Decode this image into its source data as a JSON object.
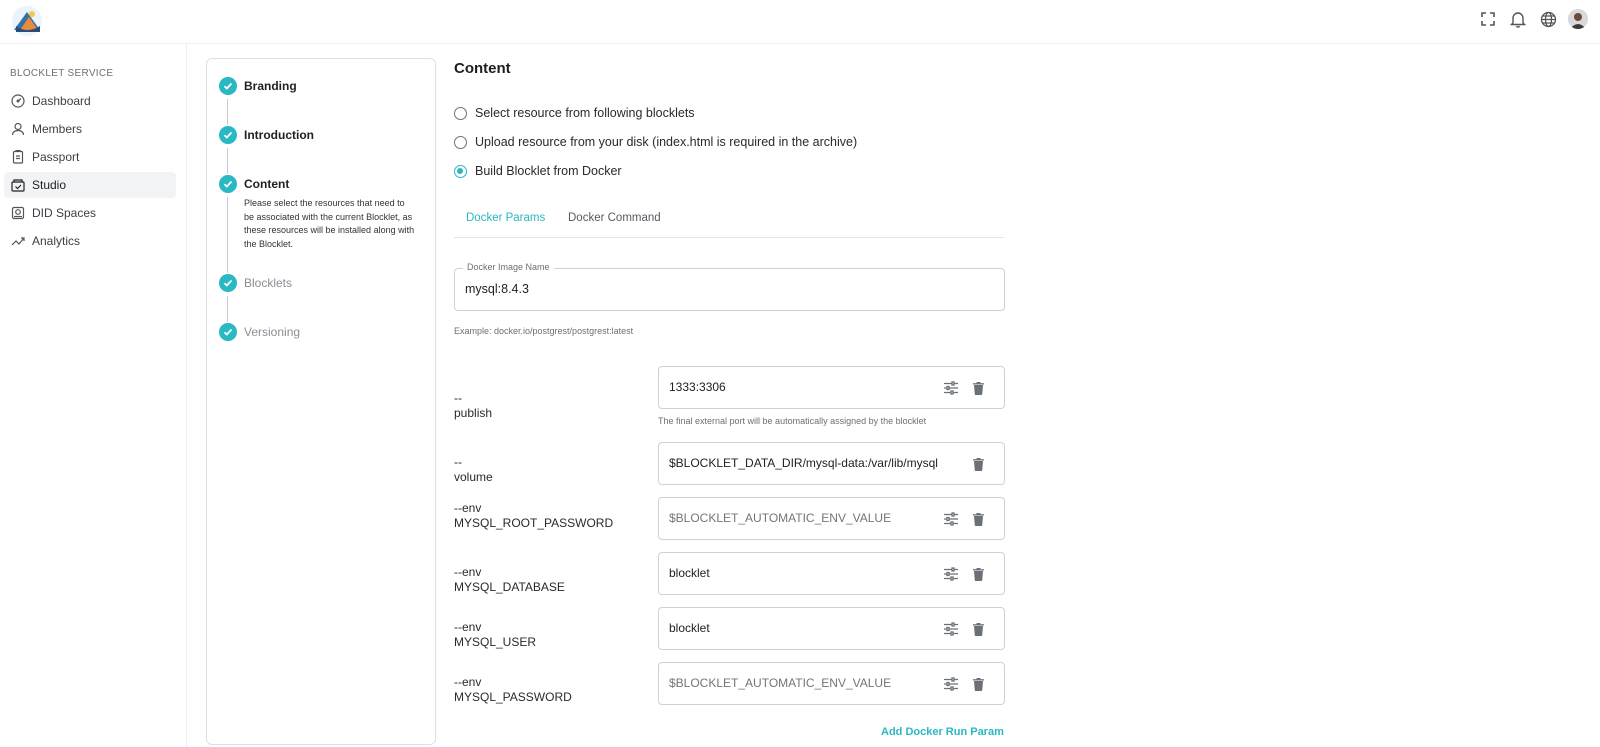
{
  "header": {
    "icons": [
      "fullscreen-icon",
      "bell-icon",
      "globe-icon",
      "avatar"
    ]
  },
  "sidebar": {
    "heading": "BLOCKLET SERVICE",
    "items": [
      {
        "label": "Dashboard",
        "icon": "dashboard-icon",
        "active": false
      },
      {
        "label": "Members",
        "icon": "user-icon",
        "active": false
      },
      {
        "label": "Passport",
        "icon": "passport-icon",
        "active": false
      },
      {
        "label": "Studio",
        "icon": "studio-icon",
        "active": true
      },
      {
        "label": "DID Spaces",
        "icon": "did-spaces-icon",
        "active": false
      },
      {
        "label": "Analytics",
        "icon": "analytics-icon",
        "active": false
      }
    ]
  },
  "stepper": {
    "steps": [
      {
        "label": "Branding",
        "done": true
      },
      {
        "label": "Introduction",
        "done": true
      },
      {
        "label": "Content",
        "done": true,
        "description": "Please select the resources that need to be associated with the current Blocklet, as these resources will be installed along with the Blocklet."
      },
      {
        "label": "Blocklets",
        "done": true
      },
      {
        "label": "Versioning",
        "done": true
      }
    ]
  },
  "content": {
    "title": "Content",
    "options": [
      {
        "label": "Select resource from following blocklets",
        "checked": false
      },
      {
        "label": "Upload resource from your disk (index.html is required in the archive)",
        "checked": false
      },
      {
        "label": "Build Blocklet from Docker",
        "checked": true
      }
    ],
    "tabs": [
      {
        "label": "Docker Params",
        "active": true
      },
      {
        "label": "Docker Command",
        "active": false
      }
    ],
    "image_field": {
      "label": "Docker Image Name",
      "value": "mysql:8.4.3",
      "hint": "Example: docker.io/postgrest/postgrest:latest"
    },
    "params": [
      {
        "label": "--publish",
        "value": "1333:3306",
        "placeholder": "",
        "has_settings": true,
        "helper": "The final external port will be automatically assigned by the blocklet"
      },
      {
        "label": "--volume",
        "value": "$BLOCKLET_DATA_DIR/mysql-data:/var/lib/mysql",
        "placeholder": "",
        "has_settings": false,
        "helper": ""
      },
      {
        "label": "--env MYSQL_ROOT_PASSWORD",
        "value": "",
        "placeholder": "$BLOCKLET_AUTOMATIC_ENV_VALUE",
        "has_settings": true,
        "helper": ""
      },
      {
        "label": "--env MYSQL_DATABASE",
        "value": "blocklet",
        "placeholder": "",
        "has_settings": true,
        "helper": ""
      },
      {
        "label": "--env MYSQL_USER",
        "value": "blocklet",
        "placeholder": "",
        "has_settings": true,
        "helper": ""
      },
      {
        "label": "--env MYSQL_PASSWORD",
        "value": "",
        "placeholder": "$BLOCKLET_AUTOMATIC_ENV_VALUE",
        "has_settings": true,
        "helper": ""
      }
    ],
    "add_param_label": "Add Docker Run Param"
  },
  "colors": {
    "accent": "#2ab8c3",
    "border": "#cfd3d8",
    "text": "#222222",
    "muted": "#6b6f76"
  }
}
